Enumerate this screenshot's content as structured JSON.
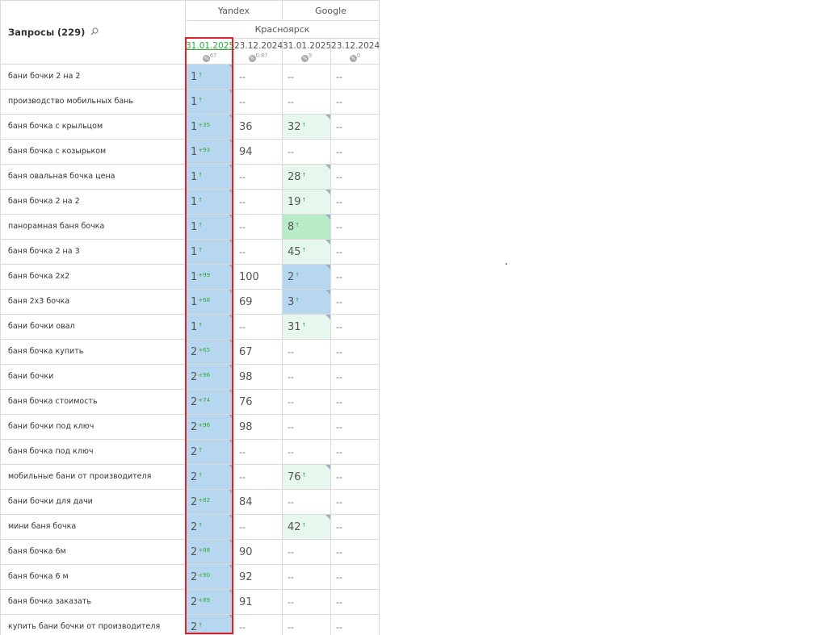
{
  "header": {
    "query_label": "Запросы",
    "query_count": "(229)",
    "engines": [
      "Yandex",
      "Google"
    ],
    "city": "Красноярск",
    "dates": [
      {
        "date": "31.01.2025",
        "meta": "67",
        "active": true
      },
      {
        "date": "23.12.2024",
        "meta": "0.87",
        "active": false
      },
      {
        "date": "31.01.2025",
        "meta": "9",
        "active": false
      },
      {
        "date": "23.12.2024",
        "meta": "0",
        "active": false
      }
    ]
  },
  "colors": {
    "blue": "#b7d7f0",
    "yellow": "#faebc7",
    "light_green": "#e6f7ed",
    "green": "#b8ecc6",
    "highlight": "#e0232a",
    "delta_green": "#2eab3a"
  },
  "rows": [
    {
      "q": "бани бочки 2 на 2",
      "c": [
        {
          "v": "1",
          "s": "↑",
          "bg": "blue",
          "tri": true
        },
        {
          "v": "--",
          "bg": "yellow"
        },
        {
          "v": "--",
          "bg": "yellow"
        },
        {
          "v": "--",
          "bg": "yellow"
        }
      ]
    },
    {
      "q": "производство мобильных бань",
      "c": [
        {
          "v": "1",
          "s": "↑",
          "bg": "blue",
          "tri": true
        },
        {
          "v": "--",
          "bg": "yellow"
        },
        {
          "v": "--",
          "bg": "yellow"
        },
        {
          "v": "--",
          "bg": "yellow"
        }
      ]
    },
    {
      "q": "баня бочка с крыльцом",
      "c": [
        {
          "v": "1",
          "s": "+35",
          "bg": "blue",
          "tri": true
        },
        {
          "v": "36",
          "bg": "white"
        },
        {
          "v": "32",
          "s": "↑",
          "bg": "lgreen",
          "tri": true
        },
        {
          "v": "--",
          "bg": "yellow"
        }
      ]
    },
    {
      "q": "баня бочка с козырьком",
      "c": [
        {
          "v": "1",
          "s": "+93",
          "bg": "blue",
          "tri": true
        },
        {
          "v": "94",
          "bg": "white"
        },
        {
          "v": "--",
          "bg": "yellow"
        },
        {
          "v": "--",
          "bg": "yellow"
        }
      ]
    },
    {
      "q": "баня овальная бочка цена",
      "c": [
        {
          "v": "1",
          "s": "↑",
          "bg": "blue",
          "tri": true
        },
        {
          "v": "--",
          "bg": "yellow"
        },
        {
          "v": "28",
          "s": "↑",
          "bg": "lgreen",
          "tri": true
        },
        {
          "v": "--",
          "bg": "yellow"
        }
      ]
    },
    {
      "q": "баня бочка 2 на 2",
      "c": [
        {
          "v": "1",
          "s": "↑",
          "bg": "blue",
          "tri": true
        },
        {
          "v": "--",
          "bg": "yellow"
        },
        {
          "v": "19",
          "s": "↑",
          "bg": "lgreen",
          "tri": true
        },
        {
          "v": "--",
          "bg": "yellow"
        }
      ]
    },
    {
      "q": "панорамная баня бочка",
      "c": [
        {
          "v": "1",
          "s": "↑",
          "bg": "blue",
          "tri": true
        },
        {
          "v": "--",
          "bg": "yellow"
        },
        {
          "v": "8",
          "s": "↑",
          "bg": "green",
          "tri": true
        },
        {
          "v": "--",
          "bg": "yellow"
        }
      ]
    },
    {
      "q": "баня бочка 2 на 3",
      "c": [
        {
          "v": "1",
          "s": "↑",
          "bg": "blue",
          "tri": true
        },
        {
          "v": "--",
          "bg": "yellow"
        },
        {
          "v": "45",
          "s": "↑",
          "bg": "lgreen",
          "tri": true
        },
        {
          "v": "--",
          "bg": "yellow"
        }
      ]
    },
    {
      "q": "баня бочка 2х2",
      "c": [
        {
          "v": "1",
          "s": "+99",
          "bg": "blue",
          "tri": true
        },
        {
          "v": "100",
          "bg": "white"
        },
        {
          "v": "2",
          "s": "↑",
          "bg": "blue",
          "tri": true
        },
        {
          "v": "--",
          "bg": "yellow"
        }
      ]
    },
    {
      "q": "баня 2х3 бочка",
      "c": [
        {
          "v": "1",
          "s": "+68",
          "bg": "blue",
          "tri": true
        },
        {
          "v": "69",
          "bg": "white"
        },
        {
          "v": "3",
          "s": "↑",
          "bg": "blue",
          "tri": true
        },
        {
          "v": "--",
          "bg": "yellow"
        }
      ]
    },
    {
      "q": "бани бочки овал",
      "c": [
        {
          "v": "1",
          "s": "↑",
          "bg": "blue",
          "tri": true
        },
        {
          "v": "--",
          "bg": "yellow"
        },
        {
          "v": "31",
          "s": "↑",
          "bg": "lgreen",
          "tri": true
        },
        {
          "v": "--",
          "bg": "yellow"
        }
      ]
    },
    {
      "q": "баня бочка купить",
      "c": [
        {
          "v": "2",
          "s": "+65",
          "bg": "blue",
          "tri": true
        },
        {
          "v": "67",
          "bg": "white"
        },
        {
          "v": "--",
          "bg": "yellow"
        },
        {
          "v": "--",
          "bg": "yellow"
        }
      ]
    },
    {
      "q": "бани бочки",
      "c": [
        {
          "v": "2",
          "s": "+96",
          "bg": "blue",
          "tri": true
        },
        {
          "v": "98",
          "bg": "white"
        },
        {
          "v": "--",
          "bg": "yellow"
        },
        {
          "v": "--",
          "bg": "yellow"
        }
      ]
    },
    {
      "q": "баня бочка стоимость",
      "c": [
        {
          "v": "2",
          "s": "+74",
          "bg": "blue",
          "tri": true
        },
        {
          "v": "76",
          "bg": "white"
        },
        {
          "v": "--",
          "bg": "yellow"
        },
        {
          "v": "--",
          "bg": "yellow"
        }
      ]
    },
    {
      "q": "бани бочки под ключ",
      "c": [
        {
          "v": "2",
          "s": "+96",
          "bg": "blue",
          "tri": true
        },
        {
          "v": "98",
          "bg": "white"
        },
        {
          "v": "--",
          "bg": "yellow"
        },
        {
          "v": "--",
          "bg": "yellow"
        }
      ]
    },
    {
      "q": "баня бочка под ключ",
      "c": [
        {
          "v": "2",
          "s": "↑",
          "bg": "blue",
          "tri": true
        },
        {
          "v": "--",
          "bg": "yellow"
        },
        {
          "v": "--",
          "bg": "yellow"
        },
        {
          "v": "--",
          "bg": "yellow"
        }
      ]
    },
    {
      "q": "мобильные бани от производителя",
      "c": [
        {
          "v": "2",
          "s": "↑",
          "bg": "blue",
          "tri": true
        },
        {
          "v": "--",
          "bg": "yellow"
        },
        {
          "v": "76",
          "s": "↑",
          "bg": "lgreen",
          "tri": true
        },
        {
          "v": "--",
          "bg": "yellow"
        }
      ]
    },
    {
      "q": "бани бочки для дачи",
      "c": [
        {
          "v": "2",
          "s": "+82",
          "bg": "blue",
          "tri": true
        },
        {
          "v": "84",
          "bg": "white"
        },
        {
          "v": "--",
          "bg": "yellow"
        },
        {
          "v": "--",
          "bg": "yellow"
        }
      ]
    },
    {
      "q": "мини баня бочка",
      "c": [
        {
          "v": "2",
          "s": "↑",
          "bg": "blue",
          "tri": true
        },
        {
          "v": "--",
          "bg": "yellow"
        },
        {
          "v": "42",
          "s": "↑",
          "bg": "lgreen",
          "tri": true
        },
        {
          "v": "--",
          "bg": "yellow"
        }
      ]
    },
    {
      "q": "баня бочка 6м",
      "c": [
        {
          "v": "2",
          "s": "+88",
          "bg": "blue",
          "tri": true
        },
        {
          "v": "90",
          "bg": "white"
        },
        {
          "v": "--",
          "bg": "yellow"
        },
        {
          "v": "--",
          "bg": "yellow"
        }
      ]
    },
    {
      "q": "баня бочка 6 м",
      "c": [
        {
          "v": "2",
          "s": "+90",
          "bg": "blue",
          "tri": true
        },
        {
          "v": "92",
          "bg": "white"
        },
        {
          "v": "--",
          "bg": "yellow"
        },
        {
          "v": "--",
          "bg": "yellow"
        }
      ]
    },
    {
      "q": "баня бочка заказать",
      "c": [
        {
          "v": "2",
          "s": "+89",
          "bg": "blue",
          "tri": true
        },
        {
          "v": "91",
          "bg": "white"
        },
        {
          "v": "--",
          "bg": "yellow"
        },
        {
          "v": "--",
          "bg": "yellow"
        }
      ]
    },
    {
      "q": "купить бани бочки от производителя",
      "c": [
        {
          "v": "2",
          "s": "↑",
          "bg": "blue",
          "tri": true
        },
        {
          "v": "--",
          "bg": "yellow"
        },
        {
          "v": "--",
          "bg": "yellow"
        },
        {
          "v": "--",
          "bg": "yellow"
        }
      ]
    }
  ]
}
